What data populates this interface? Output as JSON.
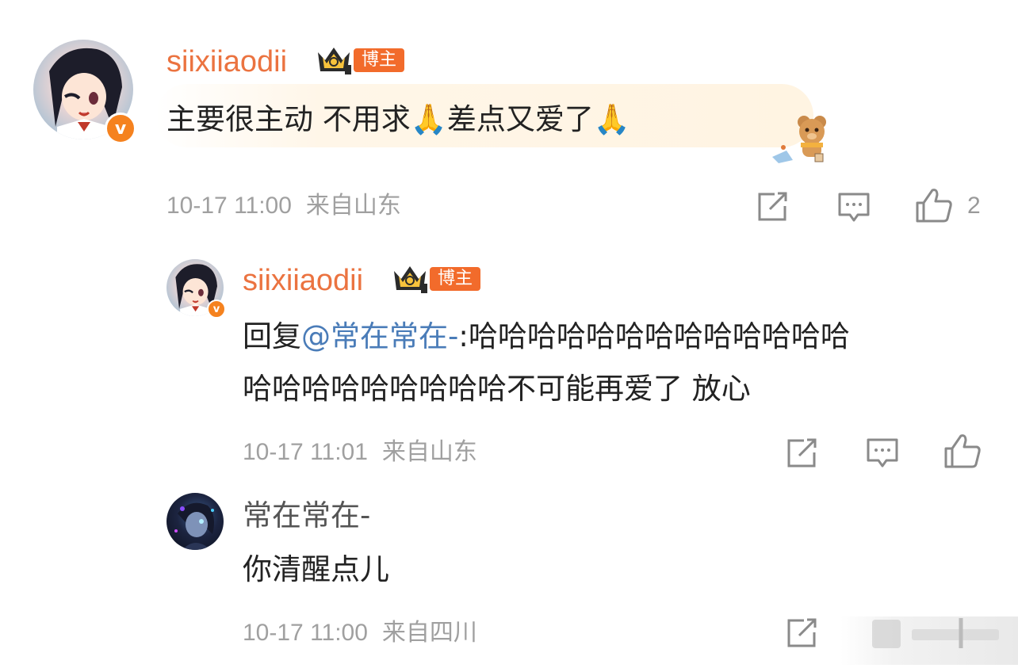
{
  "comments": [
    {
      "username": "siixiiaodii",
      "badge": "博主",
      "content": "主要很主动 不用求",
      "content_emoji_1": "🙏",
      "content_2": "差点又爱了",
      "content_emoji_2": "🙏",
      "time": "10-17 11:00",
      "location": "来自山东",
      "likes": "2"
    },
    {
      "username": "siixiiaodii",
      "badge": "博主",
      "reply_prefix": "回复",
      "mention": "@常在常在-",
      "content_line_1": ":哈哈哈哈哈哈哈哈哈哈哈哈哈",
      "content_line_2": "哈哈哈哈哈哈哈哈哈不可能再爱了 放心",
      "time": "10-17 11:01",
      "location": "来自山东"
    },
    {
      "username": "常在常在-",
      "content": "你清醒点儿",
      "time": "10-17 11:00",
      "location": "来自四川"
    }
  ],
  "colors": {
    "username": "#eb7340",
    "mention": "#4a7cb8",
    "badge": "#f26b2b",
    "meta": "#a0a0a0"
  },
  "icons": [
    "verified-v-icon",
    "crown-icon",
    "share-icon",
    "comment-icon",
    "like-icon",
    "bear-sticker-icon"
  ]
}
